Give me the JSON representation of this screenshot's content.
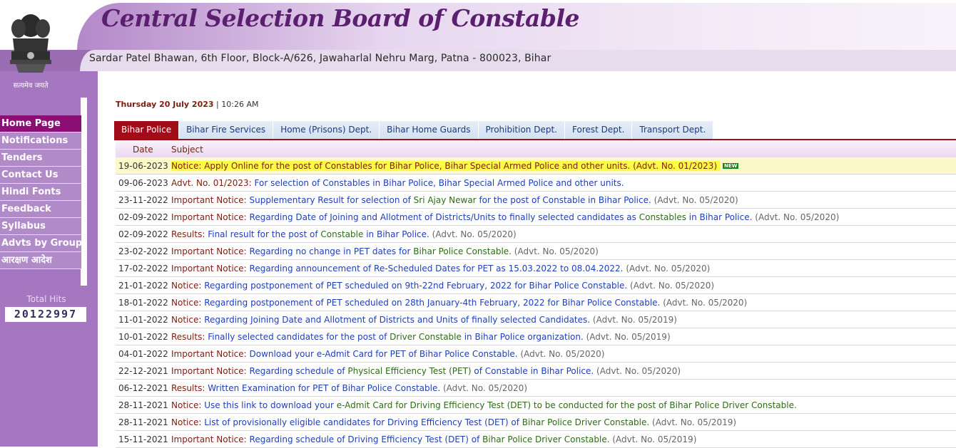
{
  "header": {
    "title": "Central Selection Board of Constable",
    "address": "Sardar Patel Bhawan, 6th Floor, Block-A/626, Jawaharlal Nehru Marg, Patna - 800023, Bihar",
    "motto": "सत्यमेव जयते"
  },
  "sidebar": {
    "items": [
      {
        "label": "Home Page"
      },
      {
        "label": "Notifications"
      },
      {
        "label": "Tenders"
      },
      {
        "label": "Contact Us"
      },
      {
        "label": "Hindi Fonts"
      },
      {
        "label": "Feedback"
      },
      {
        "label": "Syllabus"
      },
      {
        "label": "Advts by Group"
      },
      {
        "label": "आरक्षण आदेश"
      }
    ],
    "hits_label": "Total Hits",
    "hits_value": "20122997"
  },
  "datetime": {
    "date": "Thursday 20 July 2023",
    "separator": " | ",
    "time": "10:26 AM"
  },
  "tabs": [
    {
      "label": "Bihar Police"
    },
    {
      "label": "Bihar Fire Services"
    },
    {
      "label": "Home (Prisons) Dept."
    },
    {
      "label": "Bihar Home Guards"
    },
    {
      "label": "Prohibition Dept."
    },
    {
      "label": "Forest Dept."
    },
    {
      "label": "Transport Dept."
    }
  ],
  "table": {
    "headers": {
      "date": "Date",
      "subject": "Subject"
    },
    "rows": [
      {
        "date": "19-06-2023",
        "type": "Notice:",
        "pre": "Apply Online for the post of Constables for Bihar Police, Bihar Special Armed Police and other units.",
        "kw": "",
        "post": "",
        "advt": "(Advt. No. 01/2023)",
        "badge": "NEW"
      },
      {
        "date": "09-06-2023",
        "type": "Advt. No. 01/2023:",
        "pre": "For selection of Constables in Bihar Police, Bihar Special Armed Police and other units.",
        "kw": "",
        "post": "",
        "advt": ""
      },
      {
        "date": "23-11-2022",
        "type": "Important Notice:",
        "pre": "Supplementary Result for selection of",
        "kw": "Sri Ajay Newar",
        "post": "for the post of Constable in Bihar Police.",
        "advt": "(Advt. No. 05/2020)"
      },
      {
        "date": "02-09-2022",
        "type": "Important Notice:",
        "pre": "Regarding Date of Joining and Allotment of Districts/Units to finally selected candidates as",
        "kw": "Constables",
        "post": "in Bihar Police.",
        "advt": "(Advt. No. 05/2020)"
      },
      {
        "date": "02-09-2022",
        "type": "Results:",
        "pre": "Final result for the post of",
        "kw": "Constable",
        "post": "in Bihar Police.",
        "advt": "(Advt. No. 05/2020)"
      },
      {
        "date": "23-02-2022",
        "type": "Important Notice:",
        "pre": "Regarding no change in PET dates for",
        "kw": "Bihar Police Constable.",
        "post": "",
        "advt": "(Advt. No. 05/2020)"
      },
      {
        "date": "17-02-2022",
        "type": "Important Notice:",
        "pre": "Regarding announcement of Re-Scheduled Dates for PET as 15.03.2022 to 08.04.2022.",
        "kw": "",
        "post": "",
        "advt": "(Advt. No. 05/2020)"
      },
      {
        "date": "21-01-2022",
        "type": "Notice:",
        "pre": "Regarding postponement of PET scheduled on 9th-22nd February, 2022 for Bihar Police Constable.",
        "kw": "",
        "post": "",
        "advt": "(Advt. No. 05/2020)"
      },
      {
        "date": "18-01-2022",
        "type": "Notice:",
        "pre": "Regarding postponement of PET scheduled on 28th January-4th February, 2022 for Bihar Police Constable.",
        "kw": "",
        "post": "",
        "advt": "(Advt. No. 05/2020)"
      },
      {
        "date": "11-01-2022",
        "type": "Notice:",
        "pre": "Regarding Joining Date and Allotment of Districts and Units of finally selected Candidates.",
        "kw": "",
        "post": "",
        "advt": "(Advt. No. 05/2019)"
      },
      {
        "date": "10-01-2022",
        "type": "Results:",
        "pre": "Finally selected candidates for the post of",
        "kw": "Driver Constable",
        "post": "in Bihar Police organization.",
        "advt": "(Advt. No. 05/2019)"
      },
      {
        "date": "04-01-2022",
        "type": "Important Notice:",
        "pre": "Download your e-Admit Card for PET of Bihar Police Constable.",
        "kw": "",
        "post": "",
        "advt": "(Advt. No. 05/2020)"
      },
      {
        "date": "22-12-2021",
        "type": "Important Notice:",
        "pre": "Regarding schedule of",
        "kw": "Physical Efficiency Test (PET)",
        "post": "of Constable in Bihar Police.",
        "advt": "(Advt. No. 05/2020)"
      },
      {
        "date": "06-12-2021",
        "type": "Results:",
        "pre": "Written Examination for PET of Bihar Police Constable.",
        "kw": "",
        "post": "",
        "advt": "(Advt. No. 05/2020)"
      },
      {
        "date": "28-11-2021",
        "type": "Notice:",
        "pre": "Use this link to download your",
        "kw": "e-Admit Card for Driving Efficiency Test (DET) to be conducted for the post of Bihar Police Driver Constable.",
        "post": "",
        "advt": ""
      },
      {
        "date": "28-11-2021",
        "type": "Notice:",
        "pre": "List of provisionally eligible candidates for Driving Efficiency Test (DET) of",
        "kw": "Bihar Police Driver Constable.",
        "post": "",
        "advt": "(Advt. No. 05/2019)"
      },
      {
        "date": "15-11-2021",
        "type": "Important Notice:",
        "pre": "Regarding schedule of Driving Efficiency Test (DET) of",
        "kw": "Bihar Police Driver Constable.",
        "post": "",
        "advt": "(Advt. No. 05/2019)"
      }
    ]
  },
  "colors": {
    "accent": "#a00c17",
    "sidebar": "#a577c0",
    "active_menu": "#8a0e74",
    "highlight": "#fbf9c8"
  }
}
